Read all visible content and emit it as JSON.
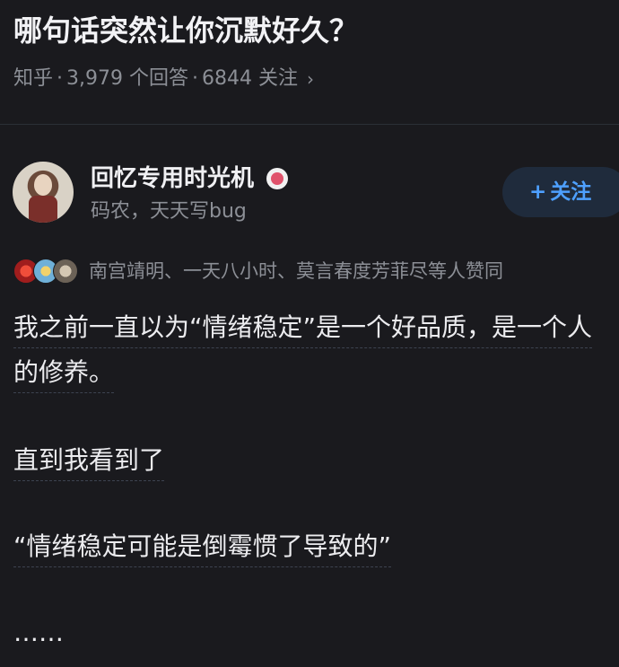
{
  "question": {
    "title": "哪句话突然让你沉默好久？",
    "source": "知乎",
    "answers": "3,979 个回答",
    "followers": "6844 关注",
    "separator": "·",
    "chevron": "›"
  },
  "author": {
    "name": "回忆专用时光机",
    "bio": "码农，天天写bug",
    "follow_label": "关注",
    "follow_plus": "+",
    "badge_icon": "verified-badge-icon"
  },
  "upvoters": {
    "text": "南宫靖明、一天八小时、莫言春度芳菲尽等人赞同"
  },
  "answer": {
    "p1": "我之前一直以为“情绪稳定”是一个好品质，是一个人的修养。",
    "p2": "直到我看到了",
    "p3": "“情绪稳定可能是倒霉惯了导致的”",
    "p4": "……"
  },
  "colors": {
    "background": "#1a1a1e",
    "accent": "#4ea0ff",
    "muted": "#8c8f96"
  }
}
